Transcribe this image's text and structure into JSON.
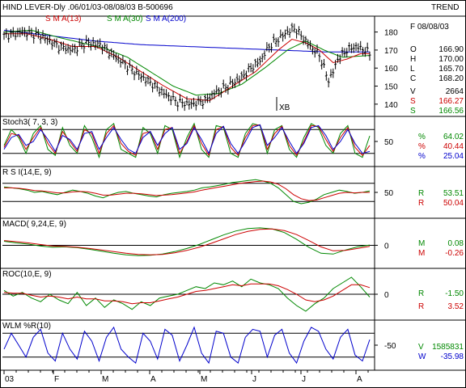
{
  "header": {
    "title": "HIND LEVER-Dly .06/01/03-08/08/03  B-500696",
    "mode": "TREND"
  },
  "colors": {
    "price": "#000000",
    "sma13": "#cc0000",
    "sma30": "#008800",
    "sma200": "#0000cc",
    "stoch_k": "#008800",
    "stoch_d": "#cc0000",
    "stoch_sd": "#0000cc",
    "frame": "#000000"
  },
  "chart_data": [
    {
      "type": "ohlc",
      "id": "price",
      "legend": [
        {
          "text": "S M A(13)",
          "color": "#cc0000"
        },
        {
          "text": "S M A(30)",
          "color": "#008800"
        },
        {
          "text": "S M A(200)",
          "color": "#0000cc"
        }
      ],
      "annotation": "XB",
      "yticks": [
        140,
        150,
        160,
        170,
        180
      ],
      "ylim": [
        135,
        187
      ],
      "readout": [
        {
          "key": "date",
          "text": "F 08/08/03",
          "color": "#000000"
        },
        {
          "key": "O",
          "text": "166.90",
          "color": "#000000"
        },
        {
          "key": "H",
          "text": "170.00",
          "color": "#000000"
        },
        {
          "key": "L",
          "text": "165.70",
          "color": "#000000"
        },
        {
          "key": "C",
          "text": "168.20",
          "color": "#000000"
        },
        {
          "key": "V",
          "text": "2664",
          "color": "#000000"
        },
        {
          "key": "S",
          "text": "166.27",
          "color": "#cc0000"
        },
        {
          "key": "S",
          "text": "166.56",
          "color": "#008800"
        }
      ],
      "close_anchors": [
        [
          0,
          178
        ],
        [
          8,
          180
        ],
        [
          16,
          178
        ],
        [
          24,
          172
        ],
        [
          30,
          170
        ],
        [
          36,
          174
        ],
        [
          42,
          173
        ],
        [
          50,
          165
        ],
        [
          58,
          157
        ],
        [
          64,
          152
        ],
        [
          70,
          146
        ],
        [
          76,
          141
        ],
        [
          82,
          140
        ],
        [
          88,
          142
        ],
        [
          92,
          146
        ],
        [
          98,
          150
        ],
        [
          104,
          155
        ],
        [
          108,
          160
        ],
        [
          112,
          164
        ],
        [
          116,
          172
        ],
        [
          120,
          176
        ],
        [
          124,
          180
        ],
        [
          127,
          182
        ],
        [
          130,
          178
        ],
        [
          134,
          172
        ],
        [
          138,
          167
        ],
        [
          140,
          160
        ],
        [
          142,
          153
        ],
        [
          144,
          158
        ],
        [
          146,
          165
        ],
        [
          150,
          170
        ],
        [
          154,
          172
        ],
        [
          158,
          170
        ],
        [
          160,
          168
        ]
      ],
      "sma13_anchors": [
        [
          0,
          179
        ],
        [
          10,
          179
        ],
        [
          20,
          176
        ],
        [
          30,
          172
        ],
        [
          40,
          172
        ],
        [
          50,
          166
        ],
        [
          60,
          158
        ],
        [
          70,
          150
        ],
        [
          80,
          143
        ],
        [
          90,
          142
        ],
        [
          100,
          150
        ],
        [
          110,
          158
        ],
        [
          120,
          170
        ],
        [
          126,
          176
        ],
        [
          132,
          174
        ],
        [
          138,
          170
        ],
        [
          144,
          163
        ],
        [
          150,
          165
        ],
        [
          156,
          168
        ],
        [
          160,
          168
        ]
      ],
      "sma30_anchors": [
        [
          0,
          180
        ],
        [
          12,
          181
        ],
        [
          24,
          177
        ],
        [
          34,
          174
        ],
        [
          44,
          171
        ],
        [
          54,
          166
        ],
        [
          64,
          158
        ],
        [
          74,
          150
        ],
        [
          84,
          145
        ],
        [
          94,
          146
        ],
        [
          104,
          151
        ],
        [
          114,
          160
        ],
        [
          124,
          170
        ],
        [
          132,
          175
        ],
        [
          140,
          170
        ],
        [
          148,
          166
        ],
        [
          160,
          167
        ]
      ],
      "sma200_anchors": [
        [
          0,
          181
        ],
        [
          20,
          178
        ],
        [
          40,
          175
        ],
        [
          60,
          173
        ],
        [
          80,
          172
        ],
        [
          100,
          171
        ],
        [
          120,
          170
        ],
        [
          140,
          169
        ],
        [
          160,
          169
        ]
      ]
    },
    {
      "type": "line",
      "id": "stoch",
      "title": "Stoch3( 7, 3, 3)",
      "yticks": [
        50
      ],
      "ylim": [
        -5,
        105
      ],
      "reference_lines": [
        20,
        80
      ],
      "readout": [
        {
          "key": "%",
          "text": "64.02",
          "color": "#008800"
        },
        {
          "key": "%",
          "text": "40.44",
          "color": "#cc0000"
        },
        {
          "key": "%",
          "text": "25.04",
          "color": "#0000cc"
        }
      ],
      "series": [
        {
          "name": "%K",
          "color": "#008800",
          "values": [
            40,
            80,
            60,
            20,
            70,
            90,
            30,
            15,
            85,
            40,
            20,
            90,
            60,
            10,
            80,
            95,
            30,
            20,
            10,
            85,
            70,
            20,
            90,
            80,
            10,
            60,
            95,
            30,
            10,
            90,
            85,
            20,
            10,
            70,
            95,
            90,
            20,
            80,
            90,
            30,
            10,
            60,
            95,
            85,
            40,
            20,
            70,
            90,
            20,
            10,
            64
          ]
        },
        {
          "name": "%D",
          "color": "#cc0000",
          "values": [
            35,
            70,
            65,
            30,
            60,
            85,
            45,
            20,
            75,
            50,
            25,
            80,
            70,
            20,
            70,
            90,
            45,
            25,
            15,
            70,
            75,
            30,
            80,
            85,
            20,
            50,
            90,
            45,
            15,
            80,
            88,
            35,
            15,
            60,
            90,
            92,
            30,
            70,
            88,
            40,
            15,
            50,
            90,
            88,
            55,
            25,
            60,
            85,
            35,
            15,
            40
          ]
        },
        {
          "name": "%SD",
          "color": "#0000cc",
          "values": [
            30,
            60,
            68,
            40,
            50,
            80,
            55,
            25,
            65,
            55,
            30,
            70,
            75,
            30,
            60,
            85,
            55,
            30,
            20,
            60,
            75,
            40,
            70,
            85,
            30,
            45,
            85,
            55,
            20,
            70,
            88,
            45,
            20,
            50,
            85,
            92,
            40,
            60,
            85,
            50,
            20,
            45,
            85,
            90,
            65,
            30,
            50,
            80,
            45,
            20,
            25
          ]
        }
      ]
    },
    {
      "type": "line",
      "id": "rsi",
      "title": "R S I(14,E, 9)",
      "yticks": [
        50
      ],
      "ylim": [
        0,
        100
      ],
      "reference_lines": [
        30,
        70
      ],
      "readout": [
        {
          "key": "R",
          "text": "53.51",
          "color": "#008800"
        },
        {
          "key": "R",
          "text": "50.04",
          "color": "#cc0000"
        }
      ],
      "series": [
        {
          "name": "RSI",
          "color": "#008800",
          "values": [
            62,
            60,
            58,
            55,
            50,
            52,
            48,
            45,
            50,
            55,
            52,
            48,
            42,
            38,
            45,
            50,
            52,
            48,
            45,
            42,
            40,
            45,
            48,
            50,
            52,
            55,
            60,
            62,
            65,
            68,
            72,
            74,
            76,
            78,
            75,
            70,
            60,
            45,
            30,
            25,
            28,
            35,
            45,
            50,
            55,
            52,
            48,
            50,
            53
          ]
        },
        {
          "name": "Signal",
          "color": "#cc0000",
          "values": [
            60,
            60,
            59,
            57,
            54,
            53,
            51,
            49,
            49,
            51,
            52,
            51,
            48,
            44,
            44,
            46,
            48,
            48,
            47,
            45,
            43,
            44,
            45,
            47,
            49,
            51,
            55,
            58,
            61,
            64,
            67,
            70,
            72,
            74,
            75,
            73,
            68,
            58,
            45,
            36,
            32,
            33,
            38,
            43,
            48,
            50,
            49,
            50,
            50
          ]
        }
      ]
    },
    {
      "type": "line",
      "id": "macd",
      "title": "MACD( 9,24,E, 9)",
      "yticks": [
        0
      ],
      "ylim": [
        -5,
        6
      ],
      "readout": [
        {
          "key": "M",
          "text": "0.08",
          "color": "#008800"
        },
        {
          "key": "M",
          "text": "-0.26",
          "color": "#cc0000"
        }
      ],
      "series": [
        {
          "name": "MACD",
          "color": "#008800",
          "values": [
            1.0,
            0.6,
            0.3,
            -0.2,
            -0.5,
            -0.4,
            -0.6,
            -1.0,
            -1.5,
            -2.0,
            -2.4,
            -2.6,
            -2.5,
            -2.2,
            -1.6,
            -0.8,
            0.2,
            1.4,
            2.6,
            3.6,
            4.2,
            4.4,
            4.1,
            3.2,
            1.5,
            -0.5,
            -2.0,
            -2.2,
            -1.2,
            -0.4,
            0.08
          ]
        },
        {
          "name": "Signal",
          "color": "#cc0000",
          "values": [
            1.2,
            0.9,
            0.6,
            0.2,
            -0.2,
            -0.3,
            -0.5,
            -0.8,
            -1.2,
            -1.6,
            -2.0,
            -2.3,
            -2.4,
            -2.3,
            -1.9,
            -1.3,
            -0.5,
            0.5,
            1.6,
            2.7,
            3.5,
            4.0,
            4.1,
            3.7,
            2.7,
            1.2,
            -0.4,
            -1.4,
            -1.3,
            -0.8,
            -0.26
          ]
        }
      ]
    },
    {
      "type": "line",
      "id": "roc",
      "title": "ROC(10,E, 9)",
      "yticks": [
        0
      ],
      "ylim": [
        -12,
        12
      ],
      "readout": [
        {
          "key": "R",
          "text": "-1.50",
          "color": "#008800"
        },
        {
          "key": "R",
          "text": "3.52",
          "color": "#cc0000"
        }
      ],
      "series": [
        {
          "name": "ROC",
          "color": "#008800",
          "values": [
            2,
            -1,
            1,
            -2,
            -4,
            0,
            -3,
            -5,
            1,
            -6,
            -2,
            -7,
            -3,
            -5,
            -8,
            -4,
            -6,
            -2,
            -1,
            0,
            2,
            4,
            3,
            6,
            5,
            7,
            4,
            8,
            6,
            5,
            3,
            -2,
            -6,
            -9,
            -5,
            -2,
            3,
            6,
            9,
            4,
            -1.5
          ]
        },
        {
          "name": "Signal",
          "color": "#cc0000",
          "values": [
            1,
            0.5,
            0.5,
            -0.5,
            -1.5,
            -1,
            -1.5,
            -2.5,
            -1.5,
            -2.5,
            -2.5,
            -3.5,
            -3.5,
            -4,
            -5,
            -4.5,
            -4.5,
            -3.5,
            -2.5,
            -1.5,
            0,
            1.5,
            2,
            3,
            4,
            5,
            4.5,
            5.5,
            5.5,
            5.5,
            4.5,
            2.5,
            0,
            -3,
            -4,
            -3,
            -1,
            2,
            5,
            5,
            3.52
          ]
        }
      ]
    },
    {
      "type": "line",
      "id": "wpr",
      "title": "WLM %R(10)",
      "yticks": [
        -50
      ],
      "ylim": [
        -105,
        5
      ],
      "reference_lines": [
        -20,
        -80
      ],
      "readout": [
        {
          "key": "V",
          "text": "1585831",
          "color": "#008800"
        },
        {
          "key": "W",
          "text": "-35.98",
          "color": "#0000cc"
        }
      ],
      "series": [
        {
          "name": "%R",
          "color": "#0000cc",
          "values": [
            -60,
            -20,
            -50,
            -80,
            -30,
            -10,
            -70,
            -90,
            -20,
            -60,
            -85,
            -15,
            -40,
            -90,
            -30,
            -5,
            -60,
            -80,
            -95,
            -20,
            -40,
            -85,
            -10,
            -25,
            -90,
            -50,
            -5,
            -70,
            -95,
            -15,
            -20,
            -80,
            -95,
            -30,
            -10,
            -15,
            -80,
            -25,
            -10,
            -70,
            -95,
            -40,
            -5,
            -15,
            -60,
            -85,
            -30,
            -10,
            -75,
            -90,
            -36
          ]
        }
      ]
    }
  ],
  "xaxis": {
    "labels": [
      "03",
      "F",
      "M",
      "A",
      "M",
      "J",
      "J",
      "A"
    ]
  }
}
